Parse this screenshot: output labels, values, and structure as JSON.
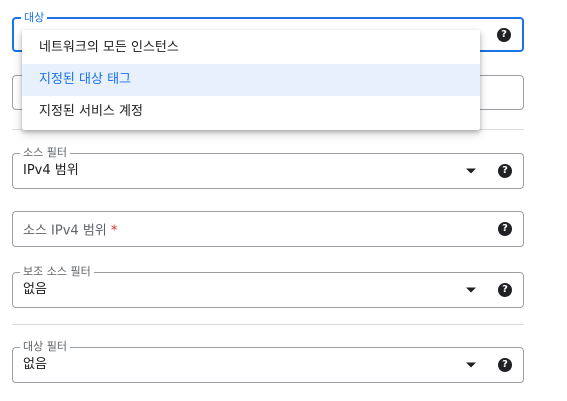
{
  "target_field": {
    "label": "대상",
    "menu_items": [
      "네트워크의 모든 인스턴스",
      "지정된 대상 태그",
      "지정된 서비스 계정"
    ],
    "selected_index": 1
  },
  "source_filter": {
    "label": "소스 필터",
    "value": "IPv4 범위"
  },
  "source_ipv4": {
    "placeholder": "소스 IPv4 범위",
    "required_mark": "*"
  },
  "secondary_source_filter": {
    "label": "보조 소스 필터",
    "value": "없음"
  },
  "destination_filter": {
    "label": "대상 필터",
    "value": "없음"
  },
  "help_icon_glyph": "?",
  "colors": {
    "accent": "#1a73e8",
    "selected_bg": "#e8f0fe",
    "required": "#d93025"
  }
}
